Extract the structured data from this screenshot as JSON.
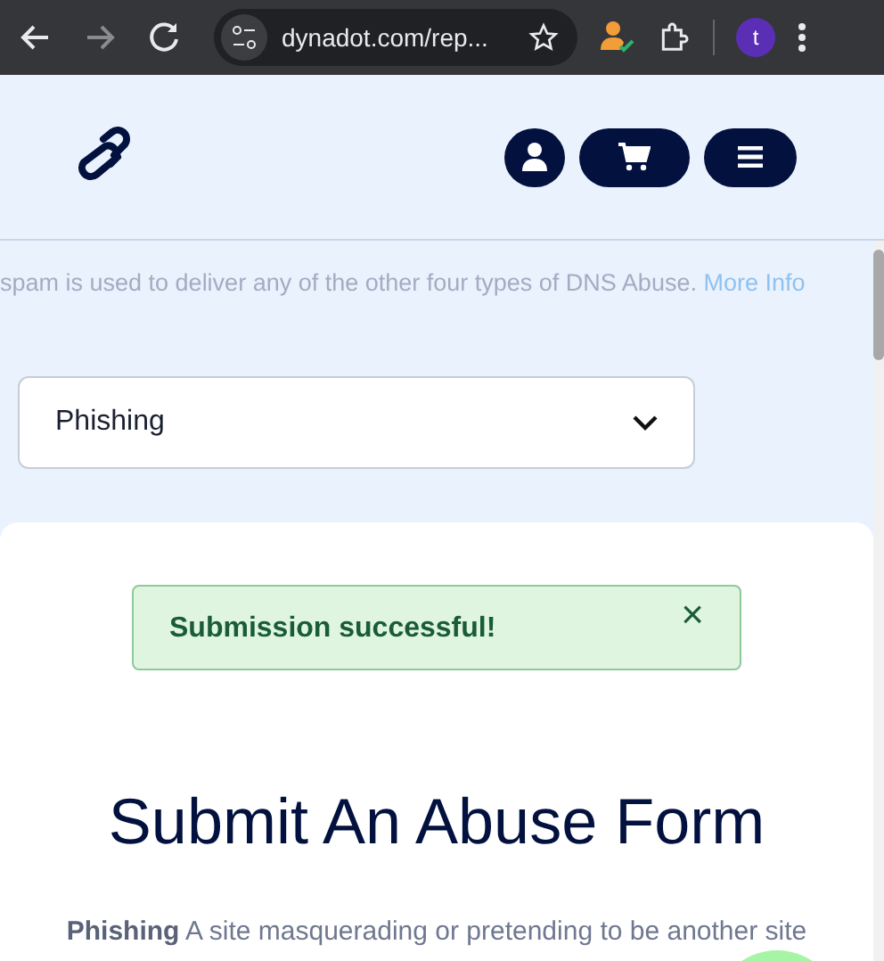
{
  "browser": {
    "url": "dynadot.com/rep...",
    "avatar_letter": "t"
  },
  "intro": {
    "text": "spam is used to deliver any of the other four types of DNS Abuse.",
    "link": "More Info"
  },
  "abuse_type": {
    "value": "Phishing"
  },
  "alert": {
    "message": "Submission successful!",
    "close": "×"
  },
  "title": "Submit An Abuse Form",
  "description": "**Phishing** A site masquerading or pretending to be another site"
}
